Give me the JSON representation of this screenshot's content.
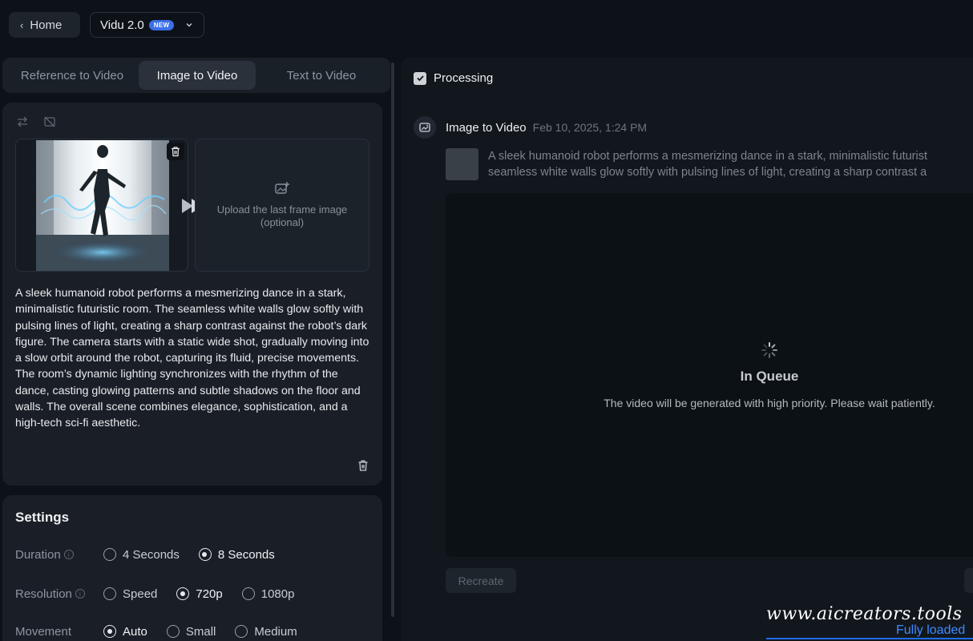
{
  "topbar": {
    "home_label": "Home",
    "model_name": "Vidu 2.0",
    "model_badge": "NEW"
  },
  "tabs": [
    {
      "label": "Reference to Video",
      "active": false
    },
    {
      "label": "Image to Video",
      "active": true
    },
    {
      "label": "Text to Video",
      "active": false
    }
  ],
  "upload": {
    "last_frame_text": "Upload the last frame image (optional)"
  },
  "prompt": {
    "text": "A sleek humanoid robot performs a mesmerizing dance in a stark, minimalistic futuristic room. The seamless white walls glow softly with pulsing lines of light, creating a sharp contrast against the robot’s dark figure. The camera starts with a static wide shot, gradually moving into a slow orbit around the robot, capturing its fluid, precise movements. The room’s dynamic lighting synchronizes with the rhythm of the dance, casting glowing patterns and subtle shadows on the floor and walls. The overall scene combines elegance, sophistication, and a high-tech sci-fi aesthetic."
  },
  "settings": {
    "title": "Settings",
    "duration": {
      "label": "Duration",
      "options": [
        "4 Seconds",
        "8 Seconds"
      ],
      "selected": "8 Seconds"
    },
    "resolution": {
      "label": "Resolution",
      "options": [
        "Speed",
        "720p",
        "1080p"
      ],
      "selected": "720p"
    },
    "movement": {
      "label": "Movement",
      "options": [
        "Auto",
        "Small",
        "Medium"
      ],
      "selected": "Auto"
    }
  },
  "task": {
    "processing_label": "Processing",
    "title": "Image to Video",
    "date": "Feb 10, 2025, 1:24 PM",
    "prompt_line1": "A sleek humanoid robot performs a mesmerizing dance in a stark, minimalistic futurist",
    "prompt_line2": "seamless white walls glow softly with pulsing lines of light, creating a sharp contrast a",
    "queue_title": "In Queue",
    "queue_sub": "The video will be generated with high priority. Please wait patiently.",
    "recreate_label": "Recreate"
  },
  "overlay": {
    "watermark": "www.aicreators.tools",
    "status": "Fully loaded"
  },
  "colors": {
    "accent": "#3b6fe8",
    "background": "#0d1218",
    "panel": "#1a1f27"
  }
}
